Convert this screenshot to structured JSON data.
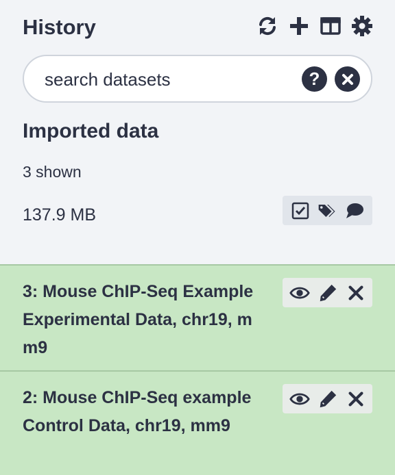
{
  "header": {
    "title": "History",
    "icons": [
      "sync-icon",
      "plus-icon",
      "columns-icon",
      "gear-icon"
    ]
  },
  "search": {
    "placeholder": "search datasets",
    "help_icon": "question-icon",
    "clear_icon": "close-icon"
  },
  "history": {
    "name": "Imported data",
    "shown": "3 shown",
    "size": "137.9 MB",
    "action_icons": [
      "check-square-icon",
      "tags-icon",
      "comment-icon"
    ]
  },
  "datasets": [
    {
      "title": "3: Mouse ChIP-Seq Example Experimental Data, chr19, mm9",
      "icons": [
        "eye-icon",
        "pencil-icon",
        "delete-icon"
      ]
    },
    {
      "title": "2: Mouse ChIP-Seq example Control Data, chr19, mm9",
      "icons": [
        "eye-icon",
        "pencil-icon",
        "delete-icon"
      ]
    }
  ],
  "colors": {
    "text": "#2c3143",
    "panel_bg": "#f2f4f7",
    "dataset_ok_bg": "#c8e7c4"
  }
}
